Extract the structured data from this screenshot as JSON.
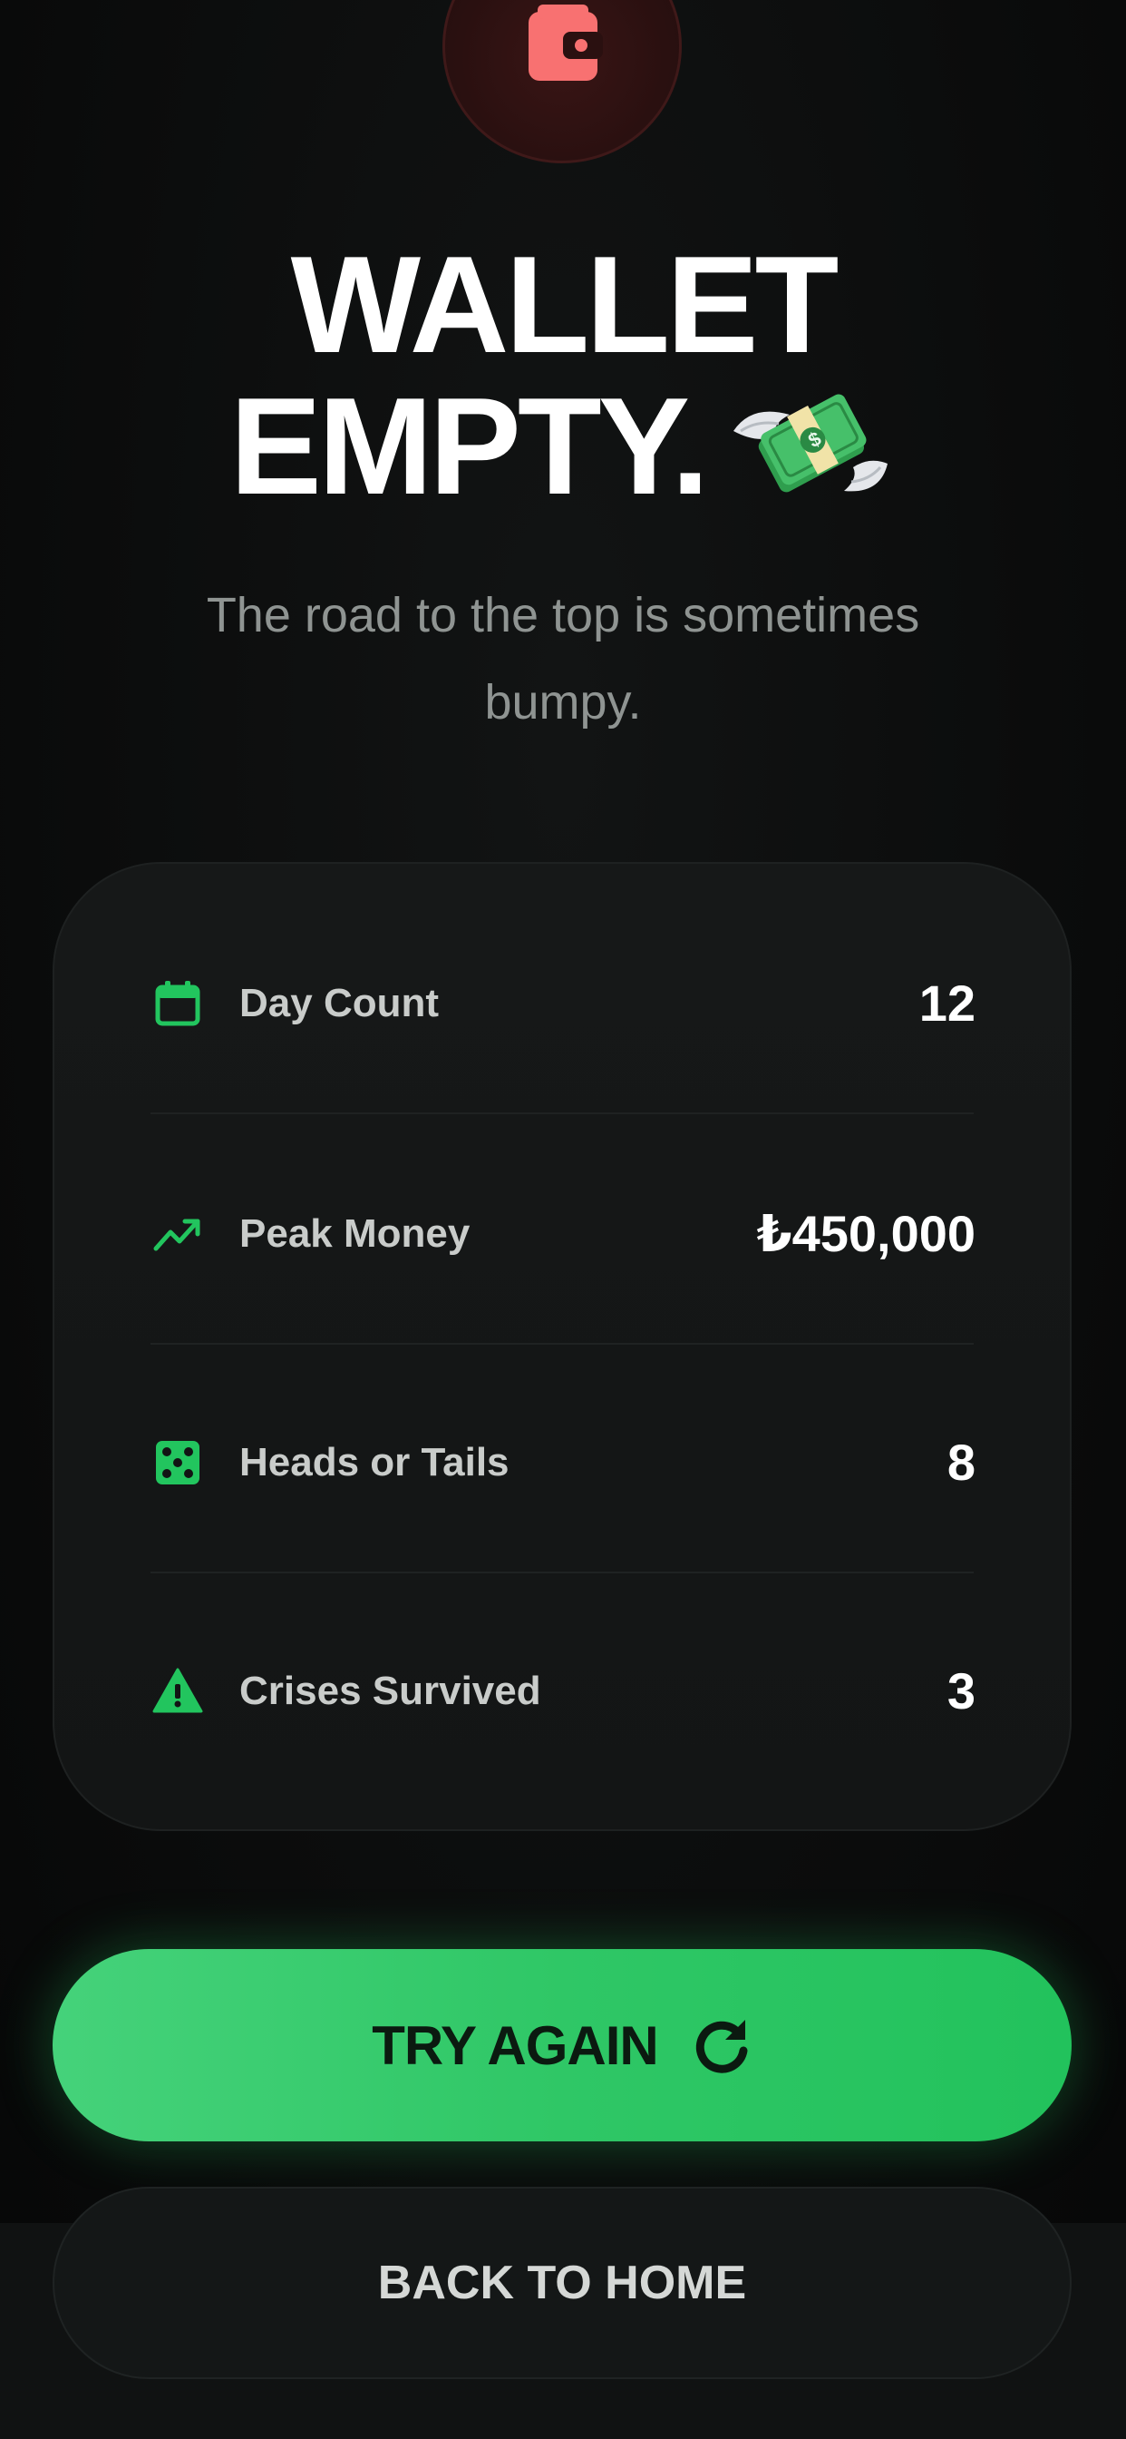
{
  "header": {
    "icon": "wallet-icon",
    "title_line1": "WALLET",
    "title_line2": "EMPTY.",
    "title_emoji": "money-with-wings-emoji",
    "subtitle": "The road to the top is sometimes bumpy."
  },
  "stats": [
    {
      "icon": "calendar-icon",
      "label": "Day Count",
      "value": "12"
    },
    {
      "icon": "trending-up-icon",
      "label": "Peak Money",
      "value": "₺450,000"
    },
    {
      "icon": "dice-icon",
      "label": "Heads or Tails",
      "value": "8"
    },
    {
      "icon": "warning-icon",
      "label": "Crises Survived",
      "value": "3"
    }
  ],
  "actions": {
    "primary_label": "TRY AGAIN",
    "primary_icon": "refresh-icon",
    "secondary_label": "BACK TO HOME"
  },
  "colors": {
    "background": "#0b0c0c",
    "accent_green": "#22c55e",
    "danger_red": "#f87171",
    "card": "#151717"
  }
}
